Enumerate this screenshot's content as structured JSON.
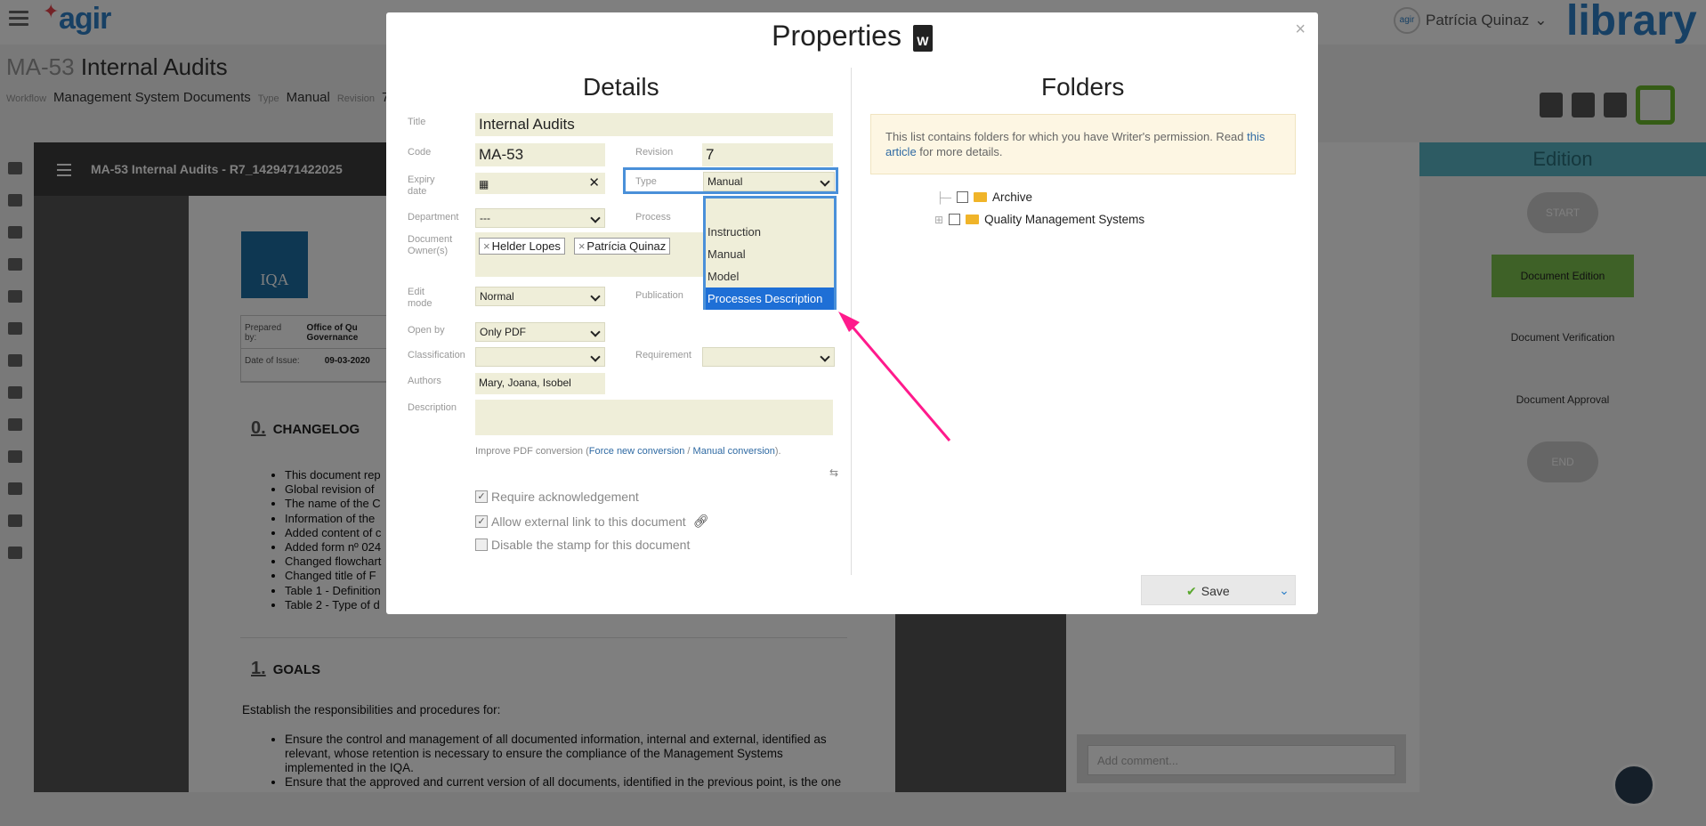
{
  "topbar": {
    "logo": "agir",
    "user_name": "Patrícia Quinaz",
    "avatar_text": "agir",
    "brand": "library"
  },
  "document": {
    "code": "MA-53",
    "title": "Internal Audits",
    "workflow_label": "Workflow",
    "workflow": "Management System Documents",
    "type_label": "Type",
    "type": "Manual",
    "revision_label": "Revision",
    "revision": "7"
  },
  "viewer": {
    "title": "MA-53 Internal Audits - R7_1429471422025",
    "logo_text": "IQA",
    "prepared_by_label": "Prepared by:",
    "prepared_by": "Office of Qu Governance",
    "date_label": "Date of Issue:",
    "date": "09-03-2020",
    "section0_num": "0.",
    "section0": "CHANGELOG",
    "changelog": [
      "This document rep",
      "Global revision of",
      "The name of the C",
      "Information of the",
      "Added content of c",
      "Added form nº 024",
      "Changed flowchart",
      "Changed title of F",
      "Table 1 - Definition",
      "Table 2 - Type of d"
    ],
    "section1_num": "1.",
    "section1": "GOALS",
    "goals_intro": "Establish the responsibilities and procedures for:",
    "goals": [
      "Ensure the control and management of all documented information, internal and external, identified as relevant, whose retention is necessary to ensure the compliance of the Management Systems implemented in the IQA.",
      "Ensure that the approved and current version of all documents, identified in the previous point, is the one"
    ]
  },
  "comment": {
    "placeholder": "Add comment..."
  },
  "edition": {
    "title": "Edition",
    "nodes": [
      "START",
      "Document Edition",
      "Document Verification",
      "Document Approval",
      "END"
    ]
  },
  "modal": {
    "title": "Properties",
    "title_icon": "W",
    "details_title": "Details",
    "folders_title": "Folders",
    "fields": {
      "title_label": "Title",
      "title_value": "Internal Audits",
      "code_label": "Code",
      "code_value": "MA-53",
      "revision_label": "Revision",
      "revision_value": "7",
      "expiry_label": "Expiry date",
      "type_label": "Type",
      "type_value": "Manual",
      "department_label": "Department",
      "department_value": "---",
      "process_label": "Process",
      "owners_label": "Document Owner(s)",
      "owners": [
        "Helder Lopes",
        "Patrícia Quinaz"
      ],
      "edit_mode_label": "Edit mode",
      "edit_mode_value": "Normal",
      "publication_label": "Publication",
      "open_by_label": "Open by",
      "open_by_value": "Only PDF",
      "classification_label": "Classification",
      "classification_value": "",
      "requirement_label": "Requirement",
      "requirement_value": "",
      "authors_label": "Authors",
      "authors_value": "Mary, Joana, Isobel",
      "description_label": "Description",
      "description_value": ""
    },
    "type_options": [
      "",
      "Instruction",
      "Manual",
      "Model",
      "Processes Description"
    ],
    "pdf_note_prefix": "Improve PDF conversion (",
    "pdf_force": "Force new conversion",
    "pdf_sep": " / ",
    "pdf_manual": "Manual conversion",
    "pdf_note_suffix": ").",
    "checkboxes": [
      {
        "label": "Require acknowledgement",
        "checked": true
      },
      {
        "label": "Allow external link to this document",
        "checked": true
      },
      {
        "label": "Disable the stamp for this document",
        "checked": false
      }
    ],
    "folders_info_prefix": "This list contains folders for which you have Writer's permission. Read ",
    "folders_info_link": "this article",
    "folders_info_suffix": " for more details.",
    "folders": [
      "Archive",
      "Quality Management Systems"
    ],
    "save_label": "Save"
  },
  "colors": {
    "accent": "#2f80c9",
    "highlight": "#1e6fd6",
    "field_bg": "#efeed9",
    "arrow": "#ff1a8c",
    "green": "#7cc24e"
  }
}
